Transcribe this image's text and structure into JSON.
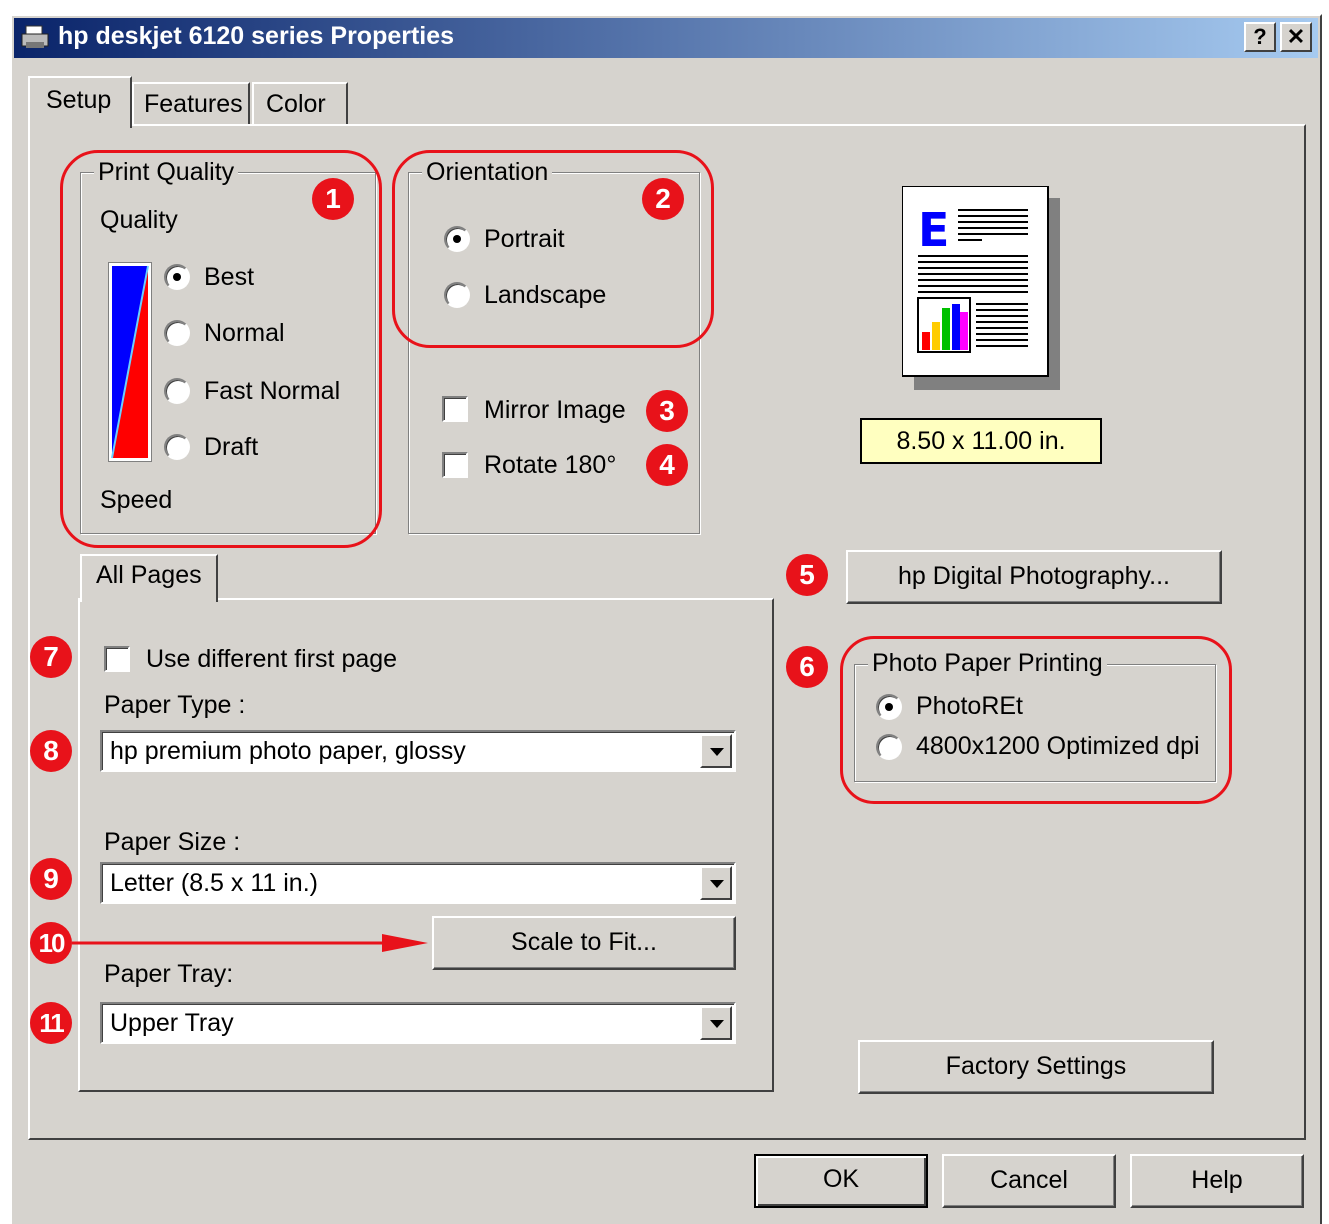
{
  "window": {
    "title": "hp deskjet 6120 series Properties",
    "help_button": "?",
    "close_button": "✕"
  },
  "tabs": [
    "Setup",
    "Features",
    "Color"
  ],
  "print_quality": {
    "legend": "Print Quality",
    "quality_label": "Quality",
    "speed_label": "Speed",
    "options": [
      "Best",
      "Normal",
      "Fast Normal",
      "Draft"
    ],
    "selected": "Best"
  },
  "orientation": {
    "legend": "Orientation",
    "portrait": "Portrait",
    "landscape": "Landscape",
    "selected": "Portrait",
    "mirror_image": "Mirror Image",
    "rotate_180": "Rotate 180°"
  },
  "preview": {
    "size_label": "8.50 x 11.00 in."
  },
  "digital_photography_button": "hp Digital Photography...",
  "photo_paper": {
    "legend": "Photo Paper Printing",
    "option1": "PhotoREt",
    "option2": "4800x1200 Optimized dpi",
    "selected": "PhotoREt"
  },
  "all_pages": {
    "tab": "All Pages",
    "use_different_first_page": "Use different first page",
    "paper_type_label": "Paper Type :",
    "paper_type_value": "hp premium photo paper, glossy",
    "paper_size_label": "Paper Size :",
    "paper_size_value": "Letter (8.5 x 11 in.)",
    "scale_to_fit_button": "Scale to Fit...",
    "paper_tray_label": "Paper Tray:",
    "paper_tray_value": "Upper Tray"
  },
  "factory_settings_button": "Factory Settings",
  "footer": {
    "ok": "OK",
    "cancel": "Cancel",
    "help": "Help"
  },
  "callouts": [
    "1",
    "2",
    "3",
    "4",
    "5",
    "6",
    "7",
    "8",
    "9",
    "10",
    "11"
  ],
  "colors": {
    "callout_red": "#e8121a",
    "titlebar_start": "#0a246a",
    "dialog_gray": "#d6d3ce",
    "size_label_bg": "#ffffc0"
  }
}
